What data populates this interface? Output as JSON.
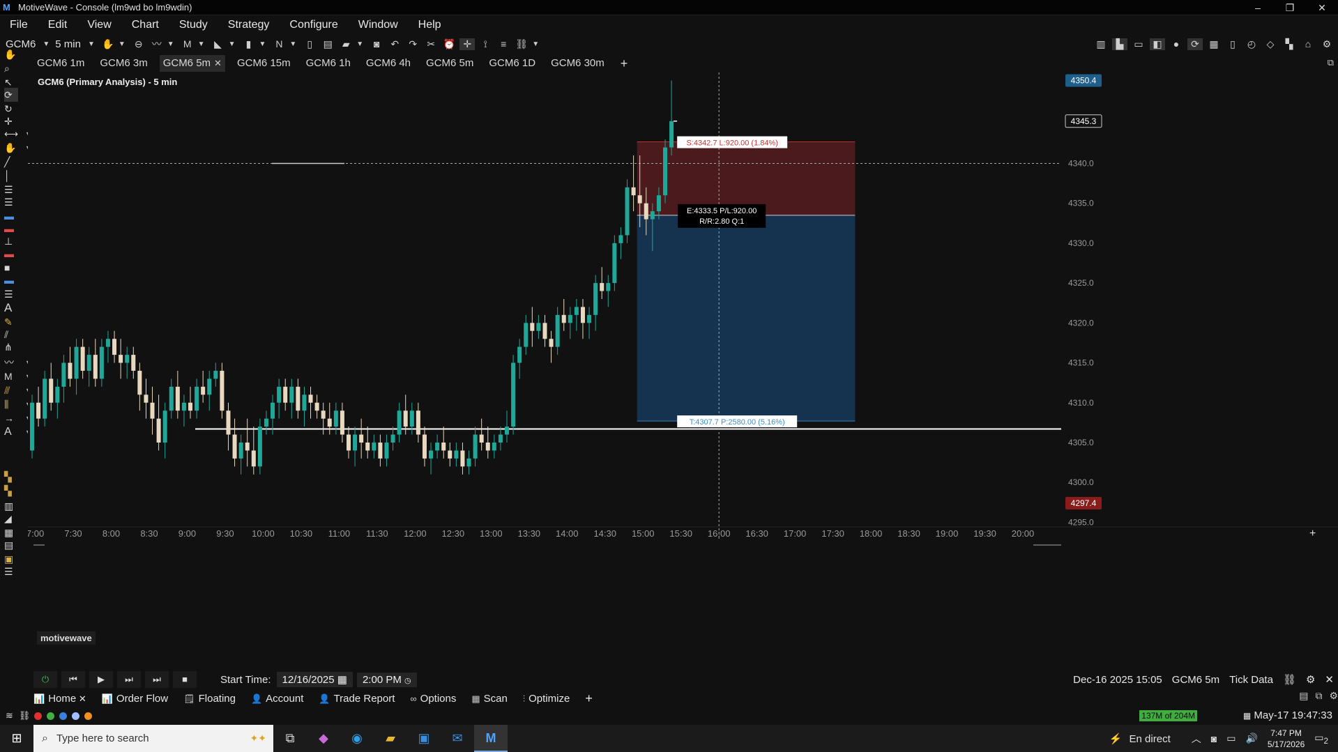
{
  "window": {
    "title": "MotiveWave - Console (lm9wd bo lm9wdin)",
    "minimize": "–",
    "maximize": "❐",
    "close": "✕"
  },
  "menu": [
    "File",
    "Edit",
    "View",
    "Chart",
    "Study",
    "Strategy",
    "Configure",
    "Window",
    "Help"
  ],
  "toolbar": {
    "symbol": "GCM6",
    "interval": "5 min",
    "n_label": "N"
  },
  "tabs": [
    {
      "label": "GCM6 1m",
      "active": false
    },
    {
      "label": "GCM6 3m",
      "active": false
    },
    {
      "label": "GCM6 5m",
      "active": true
    },
    {
      "label": "GCM6 15m",
      "active": false
    },
    {
      "label": "GCM6 1h",
      "active": false
    },
    {
      "label": "GCM6 4h",
      "active": false
    },
    {
      "label": "GCM6 5m",
      "active": false
    },
    {
      "label": "GCM6 1D",
      "active": false
    },
    {
      "label": "GCM6 30m",
      "active": false
    }
  ],
  "tab_add": "+",
  "chart": {
    "title": "GCM6 (Primary Analysis) - 5 min",
    "watermark": "motivewave",
    "price_axis": [
      "4345.0",
      "4340.0",
      "4335.0",
      "4330.0",
      "4325.0",
      "4320.0",
      "4315.0",
      "4310.0",
      "4305.0",
      "4300.0",
      "4295.0"
    ],
    "price_tags": {
      "high": {
        "value": "4350.4",
        "color": "#1f5f8b"
      },
      "current": {
        "value": "4345.3",
        "color": "#111111"
      },
      "low": {
        "value": "4297.4",
        "color": "#8b1c1c"
      }
    },
    "time_axis": [
      "7:00",
      "7:30",
      "8:00",
      "8:30",
      "9:00",
      "9:30",
      "10:00",
      "10:30",
      "11:00",
      "11:30",
      "12:00",
      "12:30",
      "13:00",
      "13:30",
      "14:00",
      "14:30",
      "15:00",
      "15:30",
      "16:00",
      "16:30",
      "17:00",
      "17:30",
      "18:00",
      "18:30",
      "19:00",
      "19:30",
      "20:00"
    ],
    "trade": {
      "stop_label": "S:4342.7 L:920.00 (1.84%)",
      "entry_label_1": "E:4333.5 P/L:920.00",
      "entry_label_2": "R/R:2.80 Q:1",
      "target_label": "T:4307.7 P:2580.00 (5.16%)",
      "stop": 4342.7,
      "entry": 4333.5,
      "target": 4307.7
    },
    "horizontal_line": 4306.7,
    "crosshair_price": 4340.0,
    "colors": {
      "up": "#1fa89a",
      "down": "#e8d8bf",
      "stop_zone": "#4a1a1c",
      "target_zone": "#15324f"
    },
    "candles": [
      [
        4304,
        4311,
        4303,
        4310
      ],
      [
        4310,
        4312,
        4307,
        4308
      ],
      [
        4308,
        4314,
        4307,
        4313
      ],
      [
        4313,
        4315,
        4309,
        4310
      ],
      [
        4310,
        4313,
        4308,
        4312
      ],
      [
        4312,
        4316,
        4310,
        4315
      ],
      [
        4315,
        4317,
        4312,
        4313
      ],
      [
        4313,
        4318,
        4311,
        4317
      ],
      [
        4317,
        4318,
        4313,
        4314
      ],
      [
        4314,
        4317,
        4312,
        4316
      ],
      [
        4316,
        4318,
        4312,
        4313
      ],
      [
        4313,
        4318,
        4312,
        4317
      ],
      [
        4317,
        4319,
        4315,
        4318
      ],
      [
        4318,
        4319,
        4315,
        4316
      ],
      [
        4316,
        4318,
        4313,
        4315
      ],
      [
        4315,
        4317,
        4313,
        4316
      ],
      [
        4316,
        4317,
        4313,
        4314
      ],
      [
        4314,
        4315,
        4309,
        4311
      ],
      [
        4311,
        4313,
        4308,
        4310
      ],
      [
        4310,
        4312,
        4306,
        4308
      ],
      [
        4308,
        4311,
        4304,
        4305
      ],
      [
        4305,
        4310,
        4303,
        4309
      ],
      [
        4309,
        4313,
        4308,
        4312
      ],
      [
        4312,
        4314,
        4308,
        4309
      ],
      [
        4309,
        4311,
        4307,
        4310
      ],
      [
        4310,
        4312,
        4308,
        4309
      ],
      [
        4309,
        4313,
        4308,
        4312
      ],
      [
        4312,
        4314,
        4310,
        4311
      ],
      [
        4311,
        4314,
        4309,
        4313
      ],
      [
        4313,
        4315,
        4312,
        4314
      ],
      [
        4314,
        4315,
        4308,
        4309
      ],
      [
        4309,
        4310,
        4304,
        4306
      ],
      [
        4306,
        4308,
        4302,
        4303
      ],
      [
        4303,
        4306,
        4301,
        4305
      ],
      [
        4305,
        4308,
        4302,
        4304
      ],
      [
        4304,
        4307,
        4301,
        4302
      ],
      [
        4302,
        4308,
        4301,
        4307
      ],
      [
        4307,
        4309,
        4306,
        4308
      ],
      [
        4308,
        4311,
        4306,
        4310
      ],
      [
        4310,
        4313,
        4308,
        4312
      ],
      [
        4312,
        4313,
        4309,
        4310
      ],
      [
        4310,
        4313,
        4308,
        4312
      ],
      [
        4312,
        4313,
        4308,
        4309
      ],
      [
        4309,
        4312,
        4307,
        4311
      ],
      [
        4311,
        4312,
        4308,
        4310
      ],
      [
        4310,
        4311,
        4308,
        4309
      ],
      [
        4309,
        4310,
        4306,
        4308
      ],
      [
        4308,
        4310,
        4306,
        4307
      ],
      [
        4307,
        4310,
        4306,
        4309
      ],
      [
        4309,
        4310,
        4305,
        4306
      ],
      [
        4306,
        4307,
        4303,
        4304
      ],
      [
        4304,
        4307,
        4302,
        4306
      ],
      [
        4306,
        4308,
        4303,
        4305
      ],
      [
        4305,
        4307,
        4303,
        4304
      ],
      [
        4304,
        4306,
        4303,
        4305
      ],
      [
        4305,
        4306,
        4302,
        4303
      ],
      [
        4303,
        4306,
        4302,
        4305
      ],
      [
        4305,
        4307,
        4304,
        4306
      ],
      [
        4306,
        4310,
        4305,
        4309
      ],
      [
        4309,
        4311,
        4306,
        4307
      ],
      [
        4307,
        4310,
        4306,
        4309
      ],
      [
        4309,
        4310,
        4305,
        4306
      ],
      [
        4306,
        4307,
        4302,
        4303
      ],
      [
        4303,
        4305,
        4301,
        4304
      ],
      [
        4304,
        4306,
        4303,
        4305
      ],
      [
        4305,
        4307,
        4303,
        4304
      ],
      [
        4304,
        4305,
        4302,
        4303
      ],
      [
        4303,
        4305,
        4302,
        4304
      ],
      [
        4304,
        4305,
        4301,
        4302
      ],
      [
        4302,
        4304,
        4301,
        4303
      ],
      [
        4303,
        4307,
        4302,
        4306
      ],
      [
        4306,
        4308,
        4304,
        4305
      ],
      [
        4305,
        4307,
        4303,
        4304
      ],
      [
        4304,
        4306,
        4303,
        4305
      ],
      [
        4305,
        4307,
        4304,
        4306
      ],
      [
        4306,
        4309,
        4305,
        4307
      ],
      [
        4307,
        4316,
        4306,
        4315
      ],
      [
        4315,
        4318,
        4313,
        4317
      ],
      [
        4317,
        4321,
        4316,
        4320
      ],
      [
        4320,
        4322,
        4317,
        4319
      ],
      [
        4319,
        4321,
        4318,
        4320
      ],
      [
        4320,
        4321,
        4317,
        4318
      ],
      [
        4318,
        4319,
        4315,
        4317
      ],
      [
        4317,
        4322,
        4316,
        4321
      ],
      [
        4321,
        4323,
        4319,
        4320
      ],
      [
        4320,
        4322,
        4318,
        4321
      ],
      [
        4321,
        4323,
        4319,
        4322
      ],
      [
        4322,
        4323,
        4318,
        4320
      ],
      [
        4320,
        4322,
        4318,
        4321
      ],
      [
        4321,
        4326,
        4319,
        4325
      ],
      [
        4325,
        4327,
        4323,
        4324
      ],
      [
        4324,
        4326,
        4322,
        4325
      ],
      [
        4325,
        4331,
        4324,
        4330
      ],
      [
        4330,
        4332,
        4328,
        4331
      ],
      [
        4331,
        4338,
        4330,
        4337
      ],
      [
        4337,
        4341,
        4334,
        4336
      ],
      [
        4336,
        4341,
        4332,
        4335
      ],
      [
        4335,
        4337,
        4331,
        4333
      ],
      [
        4333,
        4335,
        4329,
        4334
      ],
      [
        4334,
        4337,
        4333,
        4336
      ],
      [
        4336,
        4343,
        4335,
        4342
      ],
      [
        4342,
        4350.4,
        4341,
        4345.3
      ]
    ]
  },
  "playback": {
    "start_time_label": "Start Time:",
    "start_date": "12/16/2025",
    "start_clock": "2:00 PM",
    "current_info": "Dec-16 2025 15:05",
    "instrument": "GCM6 5m",
    "data_type": "Tick Data"
  },
  "dock_tabs": [
    {
      "label": "Home",
      "icon": "bar-chart-icon",
      "glyph": "📊",
      "closable": true
    },
    {
      "label": "Order Flow",
      "icon": "bar-chart-icon",
      "glyph": "📊",
      "closable": false
    },
    {
      "label": "Floating",
      "icon": "note-icon",
      "glyph": "🗒",
      "closable": false
    },
    {
      "label": "Account",
      "icon": "user-icon",
      "glyph": "👤",
      "closable": false
    },
    {
      "label": "Trade Report",
      "icon": "user-icon",
      "glyph": "👤",
      "closable": false
    },
    {
      "label": "Options",
      "icon": "link-icon",
      "glyph": "∞",
      "closable": false
    },
    {
      "label": "Scan",
      "icon": "scan-icon",
      "glyph": "▦",
      "closable": false
    },
    {
      "label": "Optimize",
      "icon": "sliders-icon",
      "glyph": "⫶",
      "closable": false
    }
  ],
  "status": {
    "memory": "137M of 204M",
    "clock": "May-17 19:47:33"
  },
  "taskbar": {
    "search_placeholder": "Type here to search",
    "news": "En direct",
    "time": "7:47 PM",
    "date": "5/17/2026",
    "notif_count": "2"
  }
}
